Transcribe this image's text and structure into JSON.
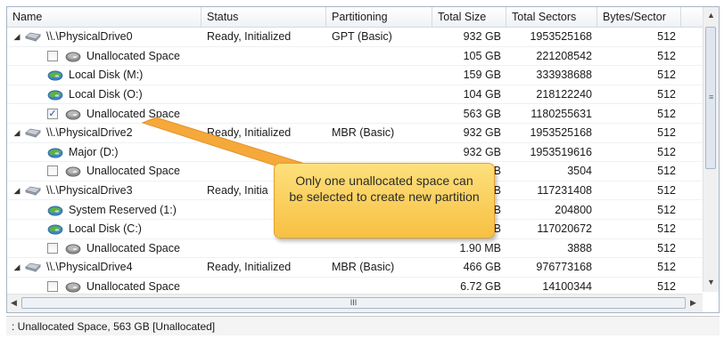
{
  "columns": {
    "name": "Name",
    "status": "Status",
    "partitioning": "Partitioning",
    "total_size": "Total Size",
    "total_sectors": "Total Sectors",
    "bytes_sector": "Bytes/Sector"
  },
  "rows": [
    {
      "type": "drive",
      "name": "\\\\.\\PhysicalDrive0",
      "status": "Ready, Initialized",
      "partitioning": "GPT (Basic)",
      "size": "932 GB",
      "sectors": "1953525168",
      "bps": "512"
    },
    {
      "type": "unalloc",
      "checked": false,
      "name": "Unallocated Space",
      "size": "105 GB",
      "sectors": "221208542",
      "bps": "512"
    },
    {
      "type": "volume",
      "name": "Local Disk (M:)",
      "size": "159 GB",
      "sectors": "333938688",
      "bps": "512"
    },
    {
      "type": "volume",
      "name": "Local Disk (O:)",
      "size": "104 GB",
      "sectors": "218122240",
      "bps": "512"
    },
    {
      "type": "unalloc",
      "checked": true,
      "name": "Unallocated Space",
      "size": "563 GB",
      "sectors": "1180255631",
      "bps": "512"
    },
    {
      "type": "drive",
      "name": "\\\\.\\PhysicalDrive2",
      "status": "Ready, Initialized",
      "partitioning": "MBR (Basic)",
      "size": "932 GB",
      "sectors": "1953525168",
      "bps": "512"
    },
    {
      "type": "volume",
      "name": "Major (D:)",
      "size": "932 GB",
      "sectors": "1953519616",
      "bps": "512"
    },
    {
      "type": "unalloc",
      "checked": false,
      "name": "Unallocated Space",
      "size": "B",
      "sectors": "3504",
      "bps": "512"
    },
    {
      "type": "drive",
      "name": "\\\\.\\PhysicalDrive3",
      "status": "Ready, Initia",
      "partitioning": "",
      "size": "B",
      "sectors": "117231408",
      "bps": "512"
    },
    {
      "type": "volume",
      "name": "System Reserved (1:)",
      "size": "B",
      "sectors": "204800",
      "bps": "512"
    },
    {
      "type": "volume",
      "name": "Local Disk (C:)",
      "size": "B",
      "sectors": "117020672",
      "bps": "512"
    },
    {
      "type": "unalloc",
      "checked": false,
      "name": "Unallocated Space",
      "size": "1.90 MB",
      "sectors": "3888",
      "bps": "512"
    },
    {
      "type": "drive",
      "name": "\\\\.\\PhysicalDrive4",
      "status": "Ready, Initialized",
      "partitioning": "MBR (Basic)",
      "size": "466 GB",
      "sectors": "976773168",
      "bps": "512"
    },
    {
      "type": "unalloc",
      "checked": false,
      "name": "Unallocated Space",
      "size": "6.72 GB",
      "sectors": "14100344",
      "bps": "512"
    }
  ],
  "scrollbar": {
    "h_grip": "III",
    "v_grip": "≡"
  },
  "status_bar": ": Unallocated Space, 563 GB [Unallocated]",
  "callout": "Only one unallocated space can be selected to create new partition",
  "icons": {
    "expander": "triangle-down-icon",
    "drive": "hard-drive-icon",
    "volume": "volume-icon",
    "unalloc": "unallocated-disk-icon"
  },
  "colors": {
    "volume_green": "#5fb33a",
    "volume_blue": "#3d85c6",
    "callout": "#f8c94c",
    "pointer": "#f39b2b"
  }
}
